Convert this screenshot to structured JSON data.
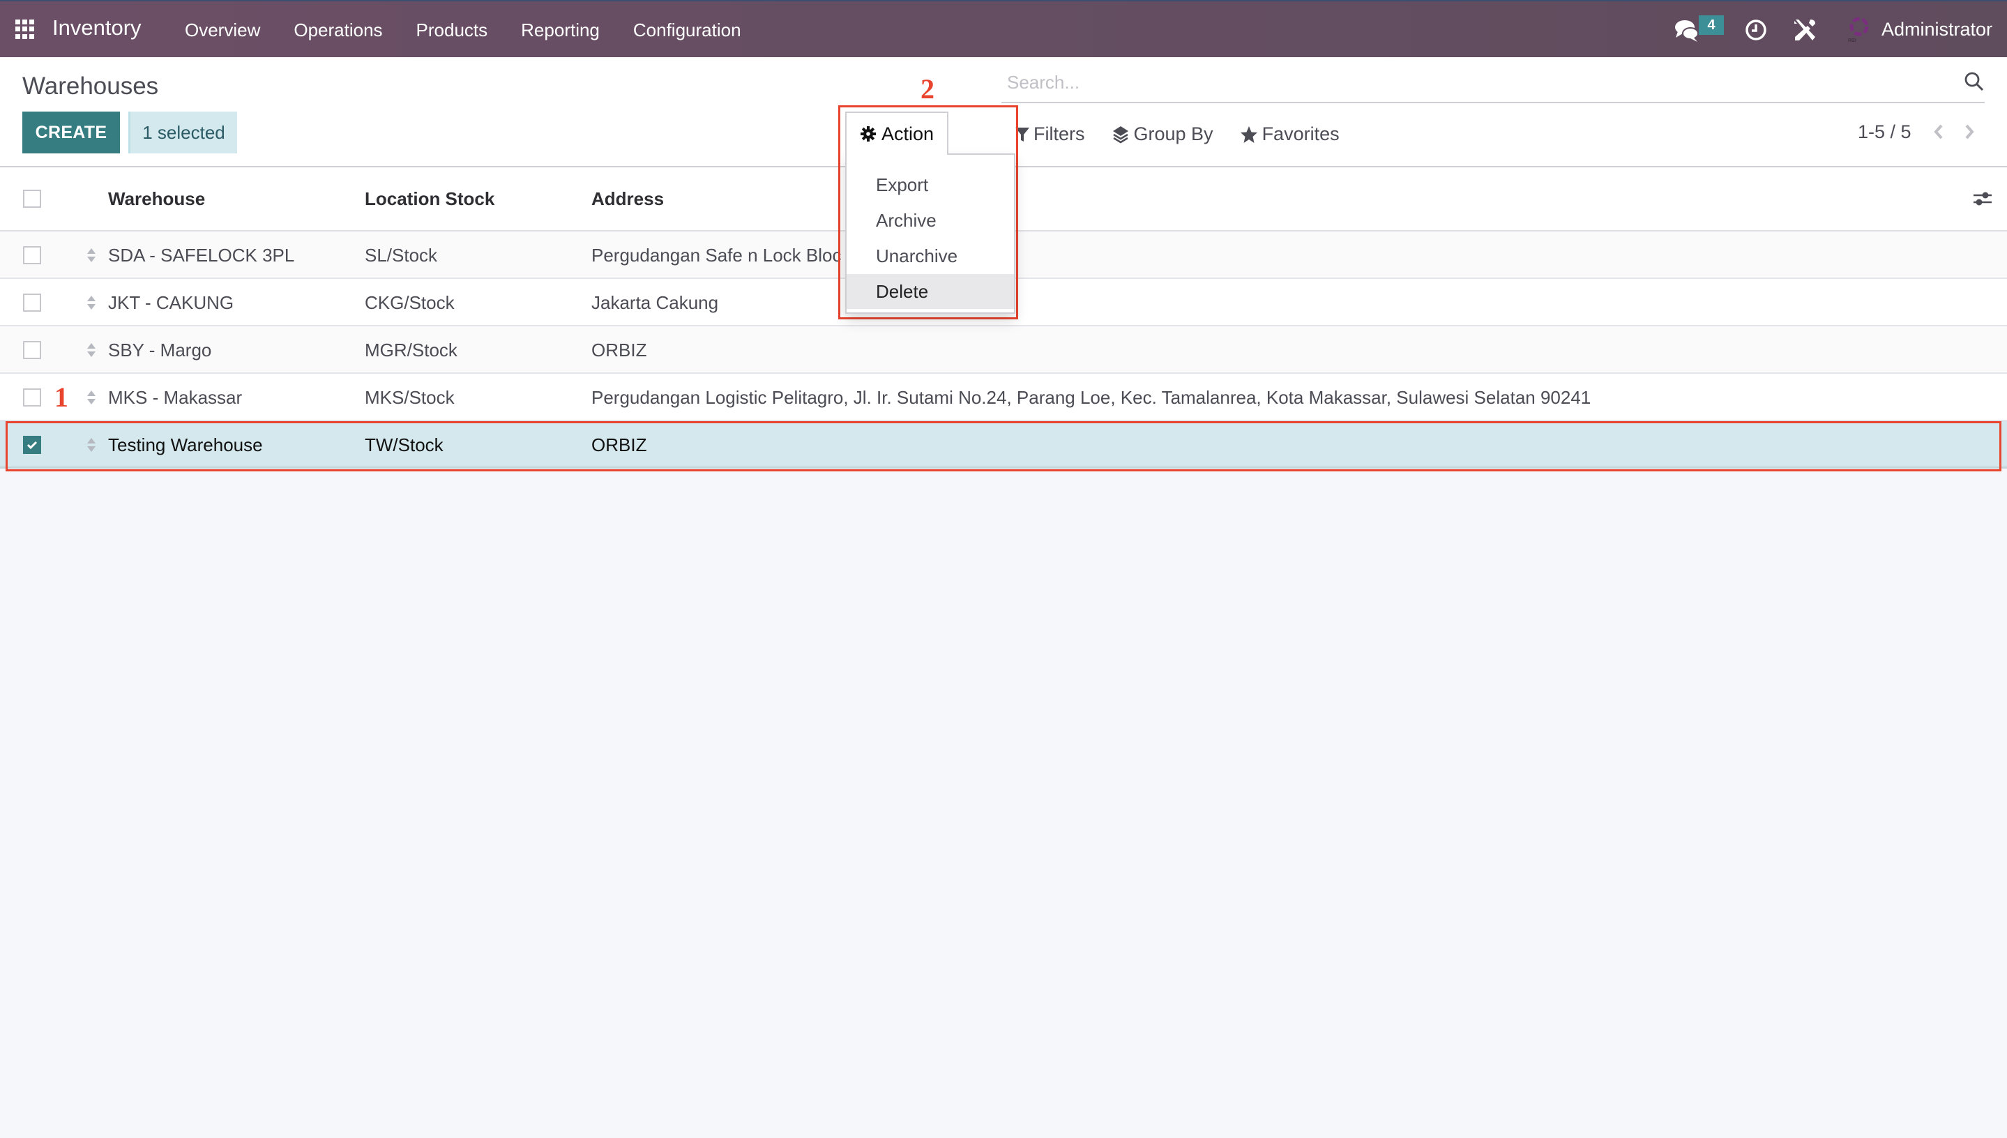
{
  "navbar": {
    "app_name": "Inventory",
    "menu": [
      "Overview",
      "Operations",
      "Products",
      "Reporting",
      "Configuration"
    ],
    "messages_badge": "4",
    "user_name": "Administrator",
    "icons": [
      "apps-grid-icon",
      "chat-icon",
      "clock-icon",
      "tools-icon",
      "company-logo"
    ]
  },
  "control_panel": {
    "title": "Warehouses",
    "create_label": "CREATE",
    "selected_label": "1 selected",
    "search_placeholder": "Search...",
    "search_value": "",
    "action_label": "Action",
    "filters_label": "Filters",
    "groupby_label": "Group By",
    "favorites_label": "Favorites",
    "pager": "1-5 / 5"
  },
  "action_menu": {
    "items": [
      "Export",
      "Archive",
      "Unarchive",
      "Delete"
    ],
    "highlighted": "Delete"
  },
  "table": {
    "columns": [
      "Warehouse",
      "Location Stock",
      "Address"
    ],
    "rows": [
      {
        "warehouse": "SDA - SAFELOCK 3PL",
        "location": "SL/Stock",
        "address": "Pergudangan Safe n Lock Bloc",
        "selected": false
      },
      {
        "warehouse": "JKT - CAKUNG",
        "location": "CKG/Stock",
        "address": "Jakarta Cakung",
        "selected": false
      },
      {
        "warehouse": "SBY - Margo",
        "location": "MGR/Stock",
        "address": "ORBIZ",
        "selected": false
      },
      {
        "warehouse": "MKS - Makassar",
        "location": "MKS/Stock",
        "address": "Pergudangan Logistic Pelitagro, Jl. Ir. Sutami No.24, Parang Loe, Kec. Tamalanrea, Kota Makassar, Sulawesi Selatan 90241",
        "selected": false
      },
      {
        "warehouse": "Testing Warehouse",
        "location": "TW/Stock",
        "address": "ORBIZ",
        "selected": true
      }
    ]
  },
  "annotations": {
    "step1": "1",
    "step2": "2"
  },
  "colors": {
    "navbar": "#6b4f66",
    "primary": "#357d80",
    "selected_row": "#d4e8ed",
    "annotation": "#e8442e",
    "badge": "#3c8f96"
  }
}
